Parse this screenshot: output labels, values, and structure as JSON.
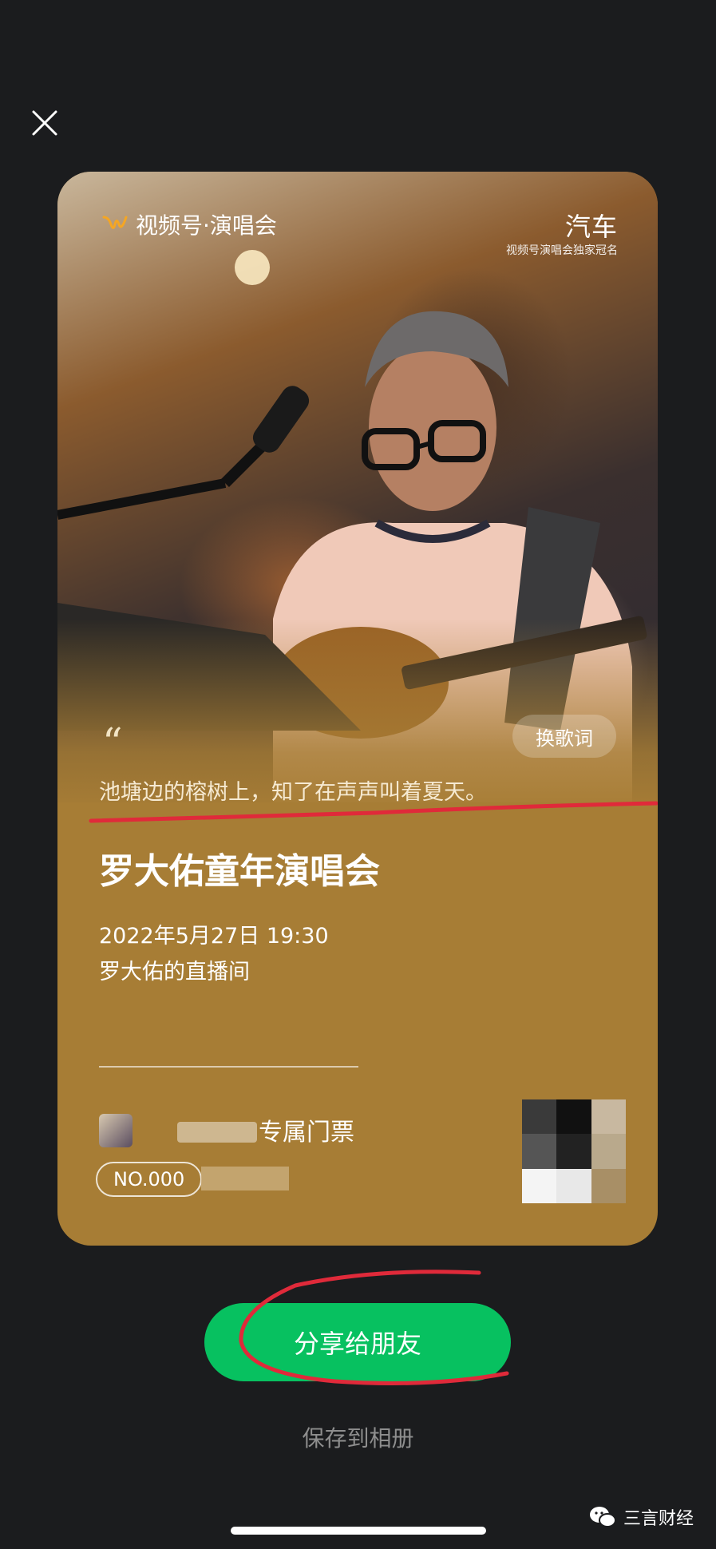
{
  "close": {
    "icon": "close-icon"
  },
  "card": {
    "brand_label": "视频号·演唱会",
    "sponsor": {
      "title": "汽车",
      "subtitle": "视频号演唱会独家冠名"
    },
    "quote_mark": "“",
    "change_lyrics_label": "换歌词",
    "lyric": "池塘边的榕树上，知了在声声叫着夏天。",
    "concert_title": "罗大佑童年演唱会",
    "datetime": "2022年5月27日 19:30",
    "room": "罗大佑的直播间",
    "ticket_label": "专属门票",
    "ticket_no": "NO.000"
  },
  "share_button_label": "分享给朋友",
  "save_album_label": "保存到相册",
  "watermark": {
    "text": "三言财经",
    "icon": "wechat-icon"
  },
  "colors": {
    "background": "#1b1c1e",
    "card": "#a77d35",
    "share_button": "#07c160",
    "annotation_red": "#e02a3a"
  }
}
